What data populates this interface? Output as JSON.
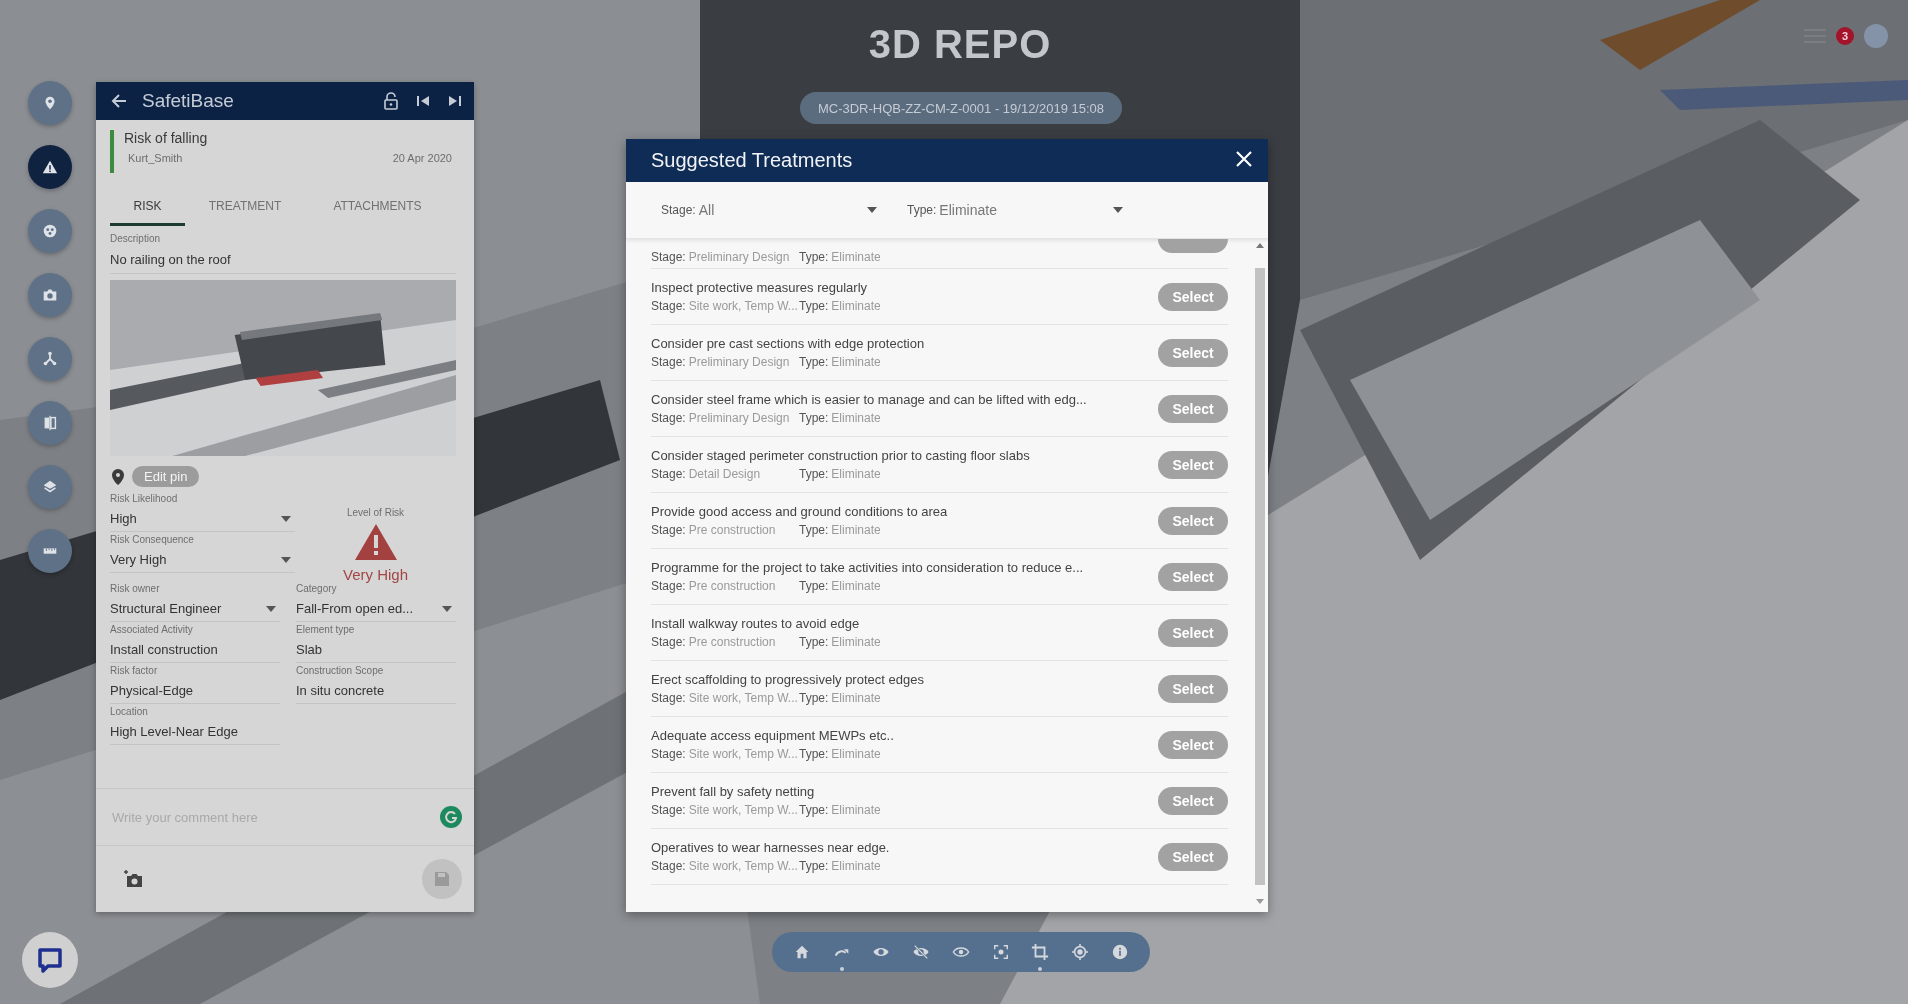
{
  "logo": "3D REPO",
  "model_chip": "MC-3DR-HQB-ZZ-CM-Z-0001 - 19/12/2019 15:08",
  "notifications": {
    "count": "3"
  },
  "left_rail": [
    {
      "kind": "pin",
      "selected": false
    },
    {
      "kind": "warning",
      "selected": true
    },
    {
      "kind": "groups",
      "selected": false
    },
    {
      "kind": "camera",
      "selected": false
    },
    {
      "kind": "tree",
      "selected": false
    },
    {
      "kind": "compare",
      "selected": false
    },
    {
      "kind": "layers",
      "selected": false
    },
    {
      "kind": "ruler",
      "selected": false
    }
  ],
  "risk_panel": {
    "title": "SafetiBase",
    "risk_name": "Risk of falling",
    "owner": "Kurt_Smith",
    "date": "20 Apr 2020",
    "tabs": [
      {
        "label": "RISK",
        "selected": true
      },
      {
        "label": "TREATMENT",
        "selected": false
      },
      {
        "label": "ATTACHMENTS",
        "selected": false
      }
    ],
    "description_label": "Description",
    "description": "No railing on the roof",
    "edit_pin": "Edit pin",
    "level_of_risk": {
      "label": "Level of Risk",
      "value": "Very High"
    },
    "fields": [
      {
        "label": "Risk Likelihood",
        "value": "High",
        "kind": "dropdown"
      },
      {
        "label": "Risk Consequence",
        "value": "Very High",
        "kind": "dropdown"
      },
      {
        "label": "Risk owner",
        "value": "Structural Engineer",
        "kind": "dropdown"
      },
      {
        "label": "Category",
        "value": "Fall-From open ed...",
        "kind": "dropdown"
      },
      {
        "label": "Associated Activity",
        "value": "Install construction",
        "kind": "text"
      },
      {
        "label": "Element type",
        "value": "Slab",
        "kind": "text"
      },
      {
        "label": "Risk factor",
        "value": "Physical-Edge",
        "kind": "text"
      },
      {
        "label": "Construction Scope",
        "value": "In situ concrete",
        "kind": "text"
      },
      {
        "label": "Location",
        "value": "High Level-Near Edge",
        "kind": "text"
      }
    ],
    "comment_placeholder": "Write your comment here"
  },
  "treatments_dialog": {
    "title": "Suggested Treatments",
    "filters": [
      {
        "label": "Stage:",
        "value": "All"
      },
      {
        "label": "Type:",
        "value": "Eliminate"
      }
    ],
    "rows": [
      {
        "stage_label": "Stage:",
        "stage": "Preliminary Design",
        "type_label": "Type:",
        "type": "Eliminate"
      },
      {
        "title": "Inspect protective measures regularly",
        "stage_label": "Stage:",
        "stage": "Site work, Temp W...",
        "type_label": "Type:",
        "type": "Eliminate",
        "button": "Select"
      },
      {
        "title": "Consider pre cast sections with edge protection",
        "stage_label": "Stage:",
        "stage": "Preliminary Design",
        "type_label": "Type:",
        "type": "Eliminate",
        "button": "Select"
      },
      {
        "title": "Consider steel frame which is easier to manage and can be lifted with edg...",
        "stage_label": "Stage:",
        "stage": "Preliminary Design",
        "type_label": "Type:",
        "type": "Eliminate",
        "button": "Select"
      },
      {
        "title": "Consider staged perimeter construction prior to casting floor slabs",
        "stage_label": "Stage:",
        "stage": "Detail Design",
        "type_label": "Type:",
        "type": "Eliminate",
        "button": "Select"
      },
      {
        "title": "Provide good access and ground conditions to area",
        "stage_label": "Stage:",
        "stage": "Pre construction",
        "type_label": "Type:",
        "type": "Eliminate",
        "button": "Select"
      },
      {
        "title": "Programme for the project to take activities into consideration to reduce e...",
        "stage_label": "Stage:",
        "stage": "Pre construction",
        "type_label": "Type:",
        "type": "Eliminate",
        "button": "Select"
      },
      {
        "title": "Install walkway routes to avoid edge",
        "stage_label": "Stage:",
        "stage": "Pre construction",
        "type_label": "Type:",
        "type": "Eliminate",
        "button": "Select"
      },
      {
        "title": "Erect scaffolding to progressively protect edges",
        "stage_label": "Stage:",
        "stage": "Site work, Temp W...",
        "type_label": "Type:",
        "type": "Eliminate",
        "button": "Select"
      },
      {
        "title": "Adequate access equipment MEWPs etc..",
        "stage_label": "Stage:",
        "stage": "Site work, Temp W...",
        "type_label": "Type:",
        "type": "Eliminate",
        "button": "Select"
      },
      {
        "title": "Prevent fall by safety netting",
        "stage_label": "Stage:",
        "stage": "Site work, Temp W...",
        "type_label": "Type:",
        "type": "Eliminate",
        "button": "Select"
      },
      {
        "title": "Operatives to wear harnesses near edge.",
        "stage_label": "Stage:",
        "stage": "Site work, Temp W...",
        "type_label": "Type:",
        "type": "Eliminate",
        "button": "Select"
      }
    ]
  },
  "toolbar": [
    {
      "kind": "home",
      "submenu": false
    },
    {
      "kind": "redo",
      "submenu": true
    },
    {
      "kind": "eye",
      "submenu": false
    },
    {
      "kind": "eye-off",
      "submenu": false
    },
    {
      "kind": "eye-outline",
      "submenu": false
    },
    {
      "kind": "focus",
      "submenu": false
    },
    {
      "kind": "crop",
      "submenu": true
    },
    {
      "kind": "target",
      "submenu": false
    },
    {
      "kind": "info",
      "submenu": false
    }
  ]
}
